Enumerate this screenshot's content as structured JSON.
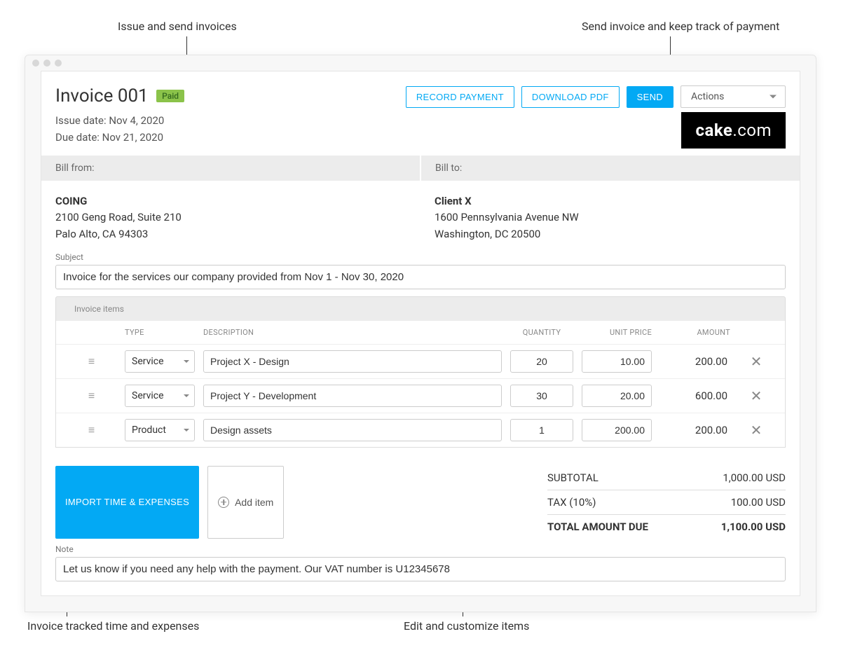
{
  "annotations": {
    "top_left": "Issue and send invoices",
    "top_right": "Send invoice and keep track of payment",
    "bottom_left": "Invoice tracked time and expenses",
    "bottom_right": "Edit and customize items"
  },
  "invoice": {
    "title": "Invoice 001",
    "status": "Paid",
    "issue_date_label": "Issue date: ",
    "issue_date": "Nov 4, 2020",
    "due_date_label": "Due date: ",
    "due_date": "Nov 21, 2020"
  },
  "toolbar": {
    "record_payment": "RECORD PAYMENT",
    "download_pdf": "DOWNLOAD PDF",
    "send": "SEND",
    "actions": "Actions"
  },
  "logo": {
    "brand": "cake",
    "tld": ".com"
  },
  "bill": {
    "from_label": "Bill from:",
    "to_label": "Bill to:",
    "from": {
      "name": "COING",
      "line1": "2100 Geng Road, Suite 210",
      "line2": "Palo Alto, CA 94303"
    },
    "to": {
      "name": "Client X",
      "line1": "1600 Pennsylvania Avenue NW",
      "line2": "Washington, DC 20500"
    }
  },
  "subject": {
    "label": "Subject",
    "value": "Invoice for the services our company provided from Nov 1 - Nov 30, 2020"
  },
  "items_section": {
    "heading": "Invoice items",
    "columns": {
      "type": "TYPE",
      "description": "DESCRIPTION",
      "quantity": "QUANTITY",
      "unit_price": "UNIT PRICE",
      "amount": "AMOUNT"
    },
    "rows": [
      {
        "type": "Service",
        "description": "Project X - Design",
        "quantity": "20",
        "unit_price": "10.00",
        "amount": "200.00"
      },
      {
        "type": "Service",
        "description": "Project Y - Development",
        "quantity": "30",
        "unit_price": "20.00",
        "amount": "600.00"
      },
      {
        "type": "Product",
        "description": "Design assets",
        "quantity": "1",
        "unit_price": "200.00",
        "amount": "200.00"
      }
    ]
  },
  "actions_below": {
    "import": "IMPORT TIME & EXPENSES",
    "add_item": "Add item"
  },
  "totals": {
    "subtotal_label": "SUBTOTAL",
    "subtotal_value": "1,000.00 USD",
    "tax_label": "TAX  (10%)",
    "tax_value": "100.00 USD",
    "total_label": "TOTAL AMOUNT DUE",
    "total_value": "1,100.00 USD"
  },
  "note": {
    "label": "Note",
    "value": "Let us know if you need any help with the payment. Our VAT number is U12345678"
  }
}
